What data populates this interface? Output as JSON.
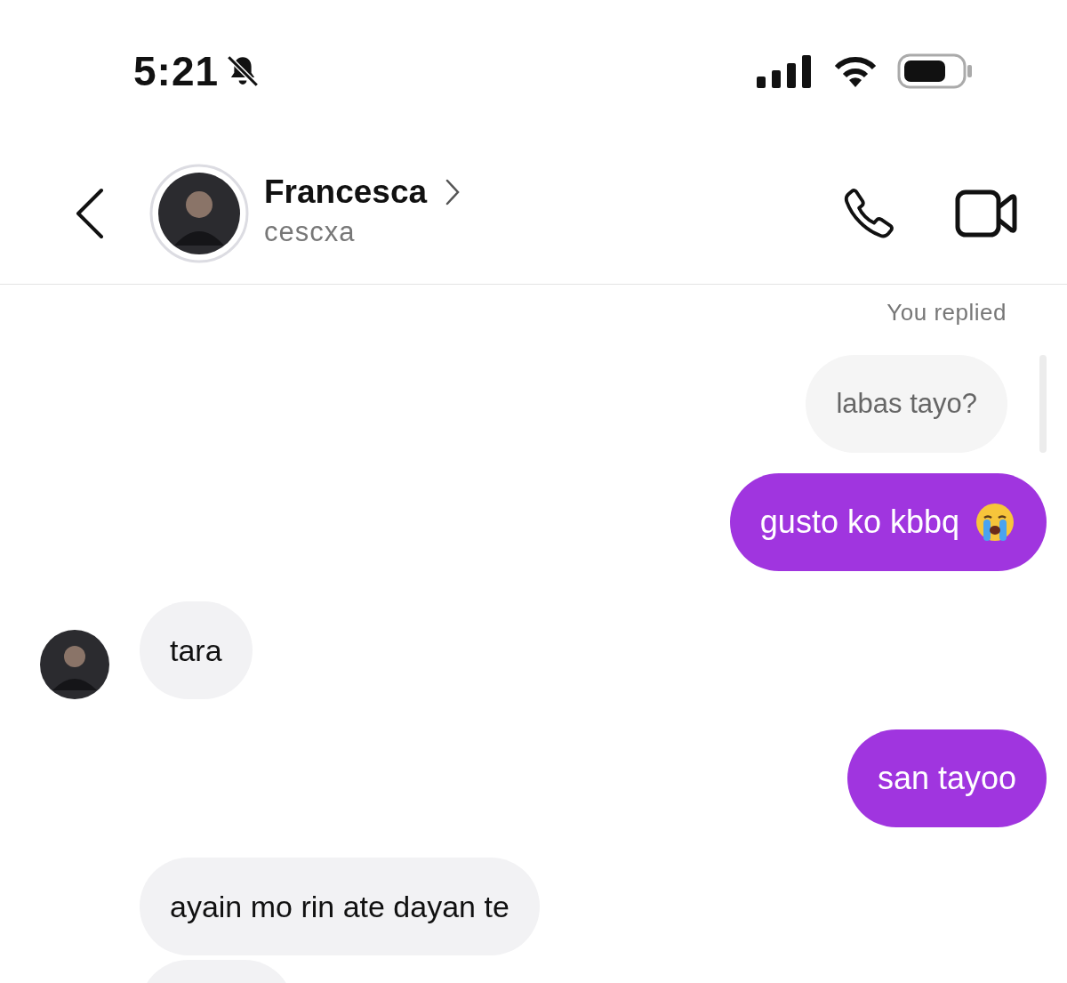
{
  "status_bar": {
    "time": "5:21"
  },
  "header": {
    "name": "Francesca",
    "username": "cescxa"
  },
  "messages": [
    {
      "kind": "label",
      "text": "You replied"
    },
    {
      "kind": "reply",
      "text": "labas tayo?"
    },
    {
      "kind": "sent",
      "text": "gusto ko kbbq",
      "emoji": true
    },
    {
      "kind": "received",
      "text": "tara",
      "avatar": true
    },
    {
      "kind": "sent",
      "text": "san tayoo"
    },
    {
      "kind": "received",
      "text": "ayain mo rin ate dayan te"
    },
    {
      "kind": "partial"
    }
  ]
}
